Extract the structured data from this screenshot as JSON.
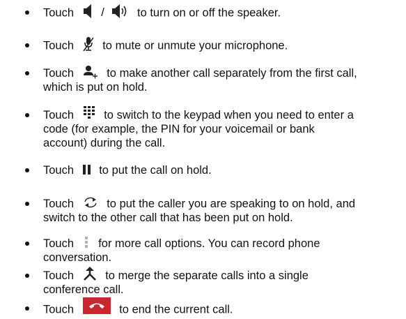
{
  "items": [
    {
      "lead": "Touch",
      "sep": "/",
      "icons": [
        "speaker-off-icon",
        "speaker-on-icon"
      ],
      "lines": [
        "to turn on or off the speaker."
      ]
    },
    {
      "lead": "Touch",
      "icons": [
        "mute-microphone-icon"
      ],
      "lines": [
        "to mute or unmute your microphone."
      ]
    },
    {
      "lead": "Touch",
      "icons": [
        "add-call-icon"
      ],
      "lines": [
        "to make another call separately from the first call,",
        "which is put on hold."
      ]
    },
    {
      "lead": "Touch",
      "icons": [
        "keypad-icon"
      ],
      "lines": [
        "to switch to the keypad when you need to enter a",
        "code (for example, the PIN for your voicemail or bank",
        "account) during the call."
      ]
    },
    {
      "lead": "Touch",
      "icons": [
        "hold-icon"
      ],
      "lines": [
        "to put the call on hold."
      ]
    },
    {
      "lead": "Touch",
      "icons": [
        "swap-calls-icon"
      ],
      "lines": [
        "to put the caller you are speaking to on hold, and",
        "switch to the other call that has been put on hold."
      ]
    },
    {
      "lead": "Touch",
      "icons": [
        "more-options-icon"
      ],
      "lines": [
        "for more call options. You can record phone",
        "conversation."
      ]
    },
    {
      "lead": "Touch",
      "icons": [
        "merge-calls-icon"
      ],
      "lines": [
        "to merge the separate calls into a single",
        "conference call."
      ]
    },
    {
      "lead": "Touch",
      "icons": [
        "end-call-icon"
      ],
      "lines": [
        "to end the current call."
      ]
    }
  ],
  "colors": {
    "text": "#111111",
    "icon": "#222222",
    "end_call_bg": "#c8282d"
  }
}
